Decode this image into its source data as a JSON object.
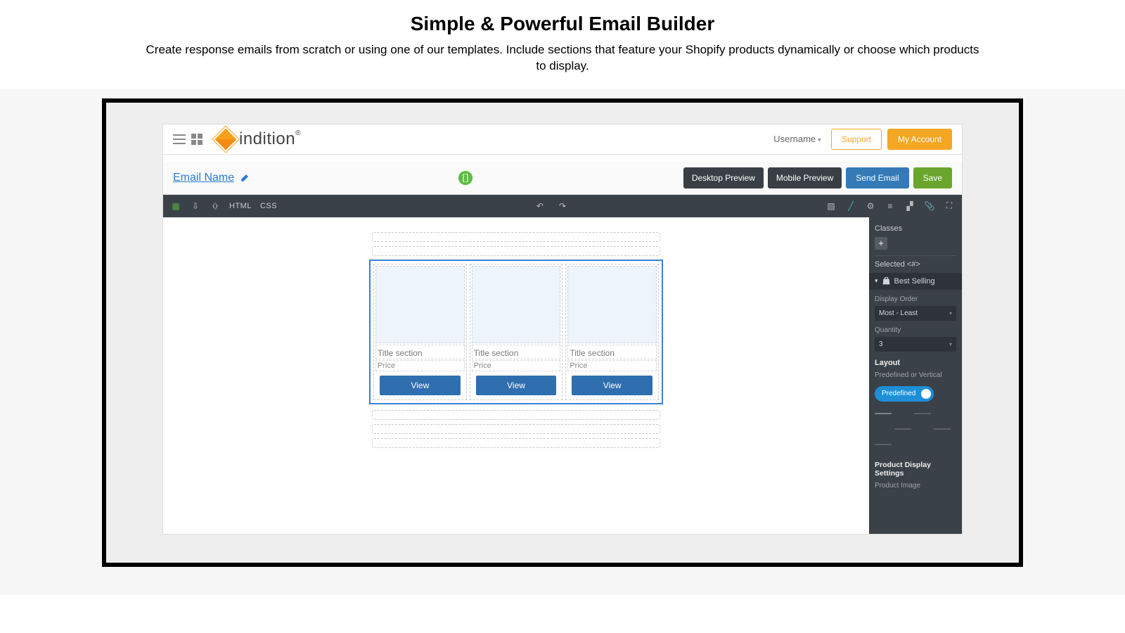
{
  "page": {
    "title": "Simple & Powerful Email Builder",
    "subtitle": "Create response emails from scratch or using one of our templates. Include sections that feature your Shopify products dynamically or choose which products to display."
  },
  "topbar": {
    "brand": "indition",
    "username": "Username",
    "support": "Support",
    "account": "My Account"
  },
  "actionbar": {
    "email_name": "Email Name",
    "desktop_preview": "Desktop Preview",
    "mobile_preview": "Mobile Preview",
    "send_email": "Send Email",
    "save": "Save"
  },
  "editbar": {
    "html": "HTML",
    "css": "CSS"
  },
  "product_card": {
    "title": "Title section",
    "price": "Price",
    "view": "View"
  },
  "panel": {
    "classes": "Classes",
    "selected": "Selected <#>",
    "section": "Best Selling",
    "display_order_label": "Display Order",
    "display_order_value": "Most - Least",
    "quantity_label": "Quantity",
    "quantity_value": "3",
    "layout": "Layout",
    "layout_mode_label": "Predefined or Vertical",
    "layout_mode_value": "Predefined",
    "product_display": "Product Display Settings",
    "product_image": "Product Image"
  }
}
